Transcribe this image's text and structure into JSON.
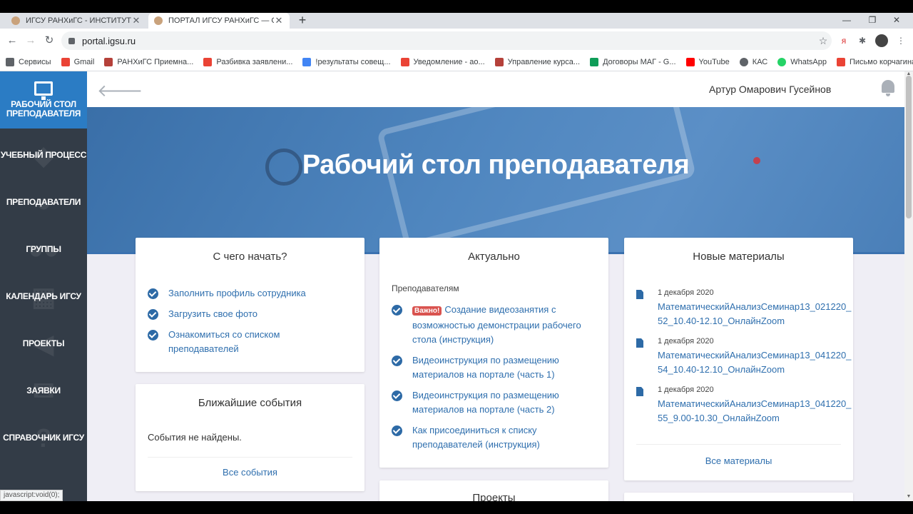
{
  "browser": {
    "tabs": [
      {
        "title": "ИГСУ РАНХиГС - ИНСТИТУТ ГОСУДАРСТВЕННОЙ",
        "close": "✕"
      },
      {
        "title": "ПОРТАЛ ИГСУ РАНХиГС — Обр",
        "close": "✕"
      }
    ],
    "new_tab": "+",
    "window_controls": {
      "minimize": "—",
      "maximize": "❐",
      "close": "✕"
    },
    "url": "portal.igsu.ru",
    "bookmarks": [
      {
        "label": "Сервисы",
        "color": "#5f6368"
      },
      {
        "label": "Gmail",
        "color": "#ea4335"
      },
      {
        "label": "РАНХиГС Приемна...",
        "color": "#b5413a"
      },
      {
        "label": "Разбивка заявлени...",
        "color": "#ea4335"
      },
      {
        "label": "!результаты совещ...",
        "color": "#4285f4"
      },
      {
        "label": "Уведомление - ао...",
        "color": "#ea4335"
      },
      {
        "label": "Управление курса...",
        "color": "#b5413a"
      },
      {
        "label": "Договоры МАГ - G...",
        "color": "#0f9d58"
      },
      {
        "label": "YouTube",
        "color": "#ff0000"
      },
      {
        "label": "КАС",
        "color": "#5f6368"
      },
      {
        "label": "WhatsApp",
        "color": "#25d366"
      },
      {
        "label": "Письмо корчагина...",
        "color": "#ea4335"
      }
    ]
  },
  "sidebar": {
    "items": [
      {
        "label": "РАБОЧИЙ СТОЛ ПРЕПОДАВАТЕЛЯ"
      },
      {
        "label": "УЧЕБНЫЙ ПРОЦЕСС"
      },
      {
        "label": "ПРЕПОДАВАТЕЛИ"
      },
      {
        "label": "ГРУППЫ"
      },
      {
        "label": "КАЛЕНДАРЬ ИГСУ"
      },
      {
        "label": "ПРОЕКТЫ"
      },
      {
        "label": "ЗАЯВКИ"
      },
      {
        "label": "СПРАВОЧНИК ИГСУ"
      }
    ]
  },
  "header": {
    "user_name": "Артур Омарович Гусейнов"
  },
  "hero": {
    "title": "Рабочий стол преподавателя"
  },
  "start_card": {
    "title": "С чего начать?",
    "items": [
      "Заполнить профиль сотрудника",
      "Загрузить свое фото",
      "Ознакомиться со списком преподавателей"
    ]
  },
  "events_card": {
    "title": "Ближайшие события",
    "empty_text": "События не найдены.",
    "all_link": "Все события"
  },
  "actual_card": {
    "title": "Актуально",
    "subheading": "Преподавателям",
    "badge": "Важно!",
    "items": [
      "Создание видеозанятия с возможностью демонстрации рабочего стола (инструкция)",
      "Видеоинструкция по размещению материалов на портале (часть 1)",
      "Видеоинструкция по размещению материалов на портале (часть 2)",
      "Как присоединиться к списку преподавателей (инструкция)"
    ]
  },
  "projects_card": {
    "title": "Проекты"
  },
  "materials_card": {
    "title": "Новые материалы",
    "items": [
      {
        "date": "1 декабря 2020",
        "name": "МатематическийАнализСеминар13_021220_52_10.40-12.10_ОнлайнZoom"
      },
      {
        "date": "1 декабря 2020",
        "name": "МатематическийАнализСеминар13_041220_54_10.40-12.10_ОнлайнZoom"
      },
      {
        "date": "1 декабря 2020",
        "name": "МатематическийАнализСеминар13_041220_55_9.00-10.30_ОнлайнZoom"
      }
    ],
    "all_link": "Все материалы"
  },
  "status_bar": "javascript:void(0);"
}
